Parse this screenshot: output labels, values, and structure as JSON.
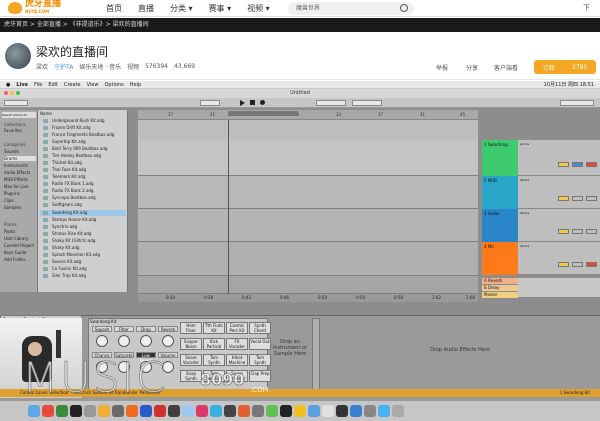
{
  "site": {
    "logo_text": "虎牙直播",
    "logo_sub": "HUYA.COM",
    "nav": [
      "首页",
      "直播",
      "分类 ▾",
      "赛事 ▾",
      "视频 ▾"
    ],
    "search_placeholder": "魔兽世界",
    "top_right": "下"
  },
  "breadcrumb": "虎牙首页 > 全部直播 > 《非提道乐》> 梁欢的直播间",
  "room": {
    "title": "梁欢的直播间",
    "host": "梁欢",
    "badge": "守护TA",
    "category": "娱乐天地 · 音乐",
    "video": "视频",
    "viewers": "576394",
    "fans": "43,669",
    "report": "举报",
    "share": "分享",
    "client": "客户端看",
    "subscribe": "订阅",
    "sub_count": "2780"
  },
  "mac": {
    "app": "Live",
    "menus": [
      "File",
      "Edit",
      "Create",
      "View",
      "Options",
      "Help"
    ],
    "clock": "10月11日 周四 18:51"
  },
  "ableton": {
    "window_title": "Untitled",
    "search": "Search (Cmd+F)",
    "collections": [
      "Collections",
      "Favorites"
    ],
    "categories": [
      "Categories",
      "Sounds",
      "Drums",
      "Instruments",
      "Audio Effects",
      "MIDI Effects",
      "Max for Live",
      "Plug-Ins",
      "Clips",
      "Samples"
    ],
    "places": [
      "Places",
      "Packs",
      "User Library",
      "Current Project",
      "Keys Guide",
      "Add Folder..."
    ],
    "list_header": "Name",
    "files": [
      "Underground Rush Kit.adg",
      "Frozen Drift Kit.adg",
      "France Fragments Beatbox.adg",
      "Supertop Kit.adg",
      "Bold Terry 909 Beatbox.adg",
      "Tim Healey Beatbox.adg",
      "Thicket Kit.adg",
      "Thai Fase Kit.adg",
      "Telemark Kit.adg",
      "Radio FX Bank 1.adg",
      "Radio FX Bank 2.adg",
      "Syncopa Beatbox.adg",
      "Swiftgears.adg",
      "Swardong Kit.adg",
      "Stamps House Kit.adg",
      "Synctrix.adg",
      "Stratus Rise Kit.adg",
      "Shaky Kit (Glitch).adg",
      "Shaky Kit.adg",
      "Splash Moonlion Kit.adg",
      "Source Kit.adg",
      "Co Fusion Kit.adg",
      "Siler Trap Kit.adg"
    ],
    "selected_file": "Swardong Kit.adg",
    "tracks": [
      {
        "name": "1 Swardong",
        "color": "#3ecb70"
      },
      {
        "name": "2 MIDI",
        "color": "#2aa6c8"
      },
      {
        "name": "3 Audio",
        "color": "#2a86c8"
      },
      {
        "name": "4 Mic",
        "color": "#ff7a1a"
      }
    ],
    "returns": [
      "A Reverb",
      "B Delay",
      "Master"
    ],
    "sends": "All Ins",
    "info_title": "Browser Content Pane",
    "info_text": "Shows the contents of the selected browser label. Double-click or drag a",
    "rack_title": "Swardong Kit",
    "macros": [
      "Squash",
      "Filter",
      "Drop",
      "Reverb",
      "Chance",
      "Saturate",
      "Low Boost",
      "Volume"
    ],
    "pads": [
      "Hom Floor Simple",
      "Tth Flute Kit",
      "Cosmic Perc Kit",
      "Synth Chord",
      "Snaper Noise",
      "Kick Partical",
      "FX Vocoder",
      "Vocal Out",
      "Snare Vocoder",
      "Tom Synth",
      "Hihat Machine",
      "Tom Synth",
      "Snap Synth",
      "Tom Swedish",
      "Snare Smasher",
      "Clap Prep"
    ],
    "drop_instrument": "Drop an Instrument or Sample Here",
    "drop_effects": "Drop Audio Effects Here",
    "status": "Control Lanes 'Selection' - Left click Sustain Kit Randomize 'Parameter'",
    "status_right": "1 Swardong Kit",
    "ruler": [
      "17",
      "21",
      "25",
      "29",
      "33",
      "37",
      "41",
      "45"
    ],
    "time_ruler": [
      "0:34",
      "0:38",
      "0:42",
      "0:46",
      "0:50",
      "0:54",
      "0:58",
      "1:02",
      "1:06"
    ]
  },
  "dock_colors": [
    "#5fa8e8",
    "#e84a3c",
    "#3a8a3a",
    "#222",
    "#999",
    "#f0b030",
    "#6a6a6a",
    "#f06a20",
    "#2a5ac8",
    "#d03030",
    "#404040",
    "#a0c8f0",
    "#d93a6a",
    "#3ab0e0",
    "#444",
    "#e06030",
    "#777",
    "#60c050",
    "#222",
    "#f0c020",
    "#5aa0e0",
    "#e0e0e0",
    "#333",
    "#3a80d0",
    "#888",
    "#4ab0f0",
    "#aaa"
  ],
  "watermark": {
    "main": "MUSIC",
    "num": "8090",
    "domain": ".COM"
  },
  "colors": {
    "accent": "#f5a623",
    "track_green": "#3ecb70",
    "track_blue": "#2aa6c8",
    "track_orange": "#ff7a1a"
  }
}
